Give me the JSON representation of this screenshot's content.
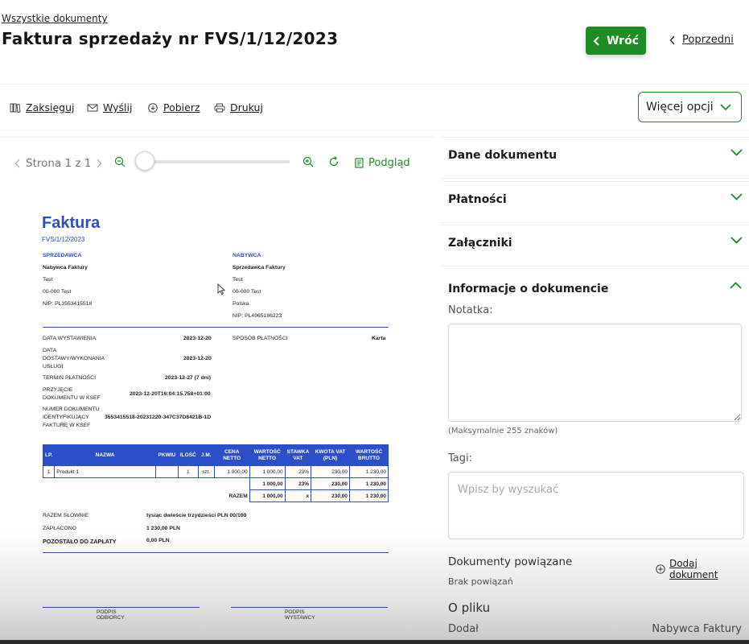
{
  "breadcrumb": "Wszystkie dokumenty",
  "title": "Faktura sprzedaży nr FVS/1/12/2023",
  "header": {
    "back_label": "Wróć",
    "prev_label": "Poprzedni"
  },
  "toolbar": {
    "post": "Zaksięguj",
    "send": "Wyślij",
    "download": "Pobierz",
    "print": "Drukuj",
    "more": "Więcej opcji"
  },
  "viewer": {
    "page_label": "Strona 1 z 1",
    "preview_label": "Podgląd"
  },
  "invoice": {
    "heading": "Faktura",
    "number": "FVS/1/12/2023",
    "seller_label": "SPRZEDAWCA",
    "seller_name": "Nabywca Faktury",
    "seller_line1": "Test",
    "seller_line2": "00-000 Test",
    "seller_nip": "NIP: PL3553415518",
    "buyer_label": "NABYWCA",
    "buyer_name": "Sprzedawca Faktury",
    "buyer_line1": "Test",
    "buyer_line2": "00-000 Test",
    "buyer_line3": "Polska",
    "buyer_nip": "NIP: PL4965186223",
    "issue_date_label": "DATA WYSTAWIENIA",
    "issue_date": "2023-12-20",
    "payment_method_label": "SPOSÓB PŁATNOŚCI",
    "payment_method": "Karta",
    "delivery_label_1": "DATA",
    "delivery_label_2": "DOSTAWY/WYKONANIA",
    "delivery_label_3": "USŁUGI",
    "delivery_date": "2023-12-20",
    "due_label": "TERMIN PŁATNOŚCI",
    "due_date": "2023-12-27 (7 dni)",
    "ksef_label_1": "PRZYJĘCIE",
    "ksef_label_2": "DOKUMENTU W KSEF",
    "ksef_date": "2023-12-20T16:04:15.758+01:00",
    "ksef_id_label_1": "NUMER DOKUMENTU",
    "ksef_id_label_2": "IDENTYFIKUJĄCY",
    "ksef_id_label_3": "FAKTURĘ W KSEF",
    "ksef_id": "3553415518-20231220-347C37D8421B-1D",
    "table_headers": [
      "LP.",
      "NAZWA",
      "PKWIU",
      "ILOŚĆ",
      "J.M.",
      "CENA NETTO",
      "WARTOŚĆ NETTO",
      "STAWKA VAT",
      "KWOTA VAT (PLN)",
      "WARTOŚĆ BRUTTO"
    ],
    "row": [
      "1",
      "Produkt 1",
      "",
      "1",
      "szt.",
      "1 000,00",
      "1 000,00",
      "23%",
      "230,00",
      "1 230,00"
    ],
    "subtotal": [
      "1 000,00",
      "23%",
      "230,00",
      "1 230,00"
    ],
    "total_label": "RAZEM",
    "total": [
      "1 000,00",
      "x",
      "230,00",
      "1 230,00"
    ],
    "words_label": "RAZEM SŁOWNIE",
    "words_value": "tysiąc dwieście trzydzieści PLN 00/100",
    "paid_label": "ZAPŁACONO",
    "paid_value": "1 230,00 PLN",
    "remaining_label": "POZOSTAŁO DO ZAPŁATY",
    "remaining_value": "0,00 PLN",
    "sign_receiver": "PODPIS ODBIORCY",
    "sign_issuer": "PODPIS WYSTAWCY"
  },
  "panel": {
    "doc_data": "Dane dokumentu",
    "payments": "Płatności",
    "attachments": "Załączniki",
    "info": "Informacje o dokumencie",
    "note_label": "Notatka:",
    "note_help": "(Maksymalnie 255 znaków)",
    "tags_label": "Tagi:",
    "tags_placeholder": "Wpisz by wyszukać",
    "related_label": "Dokumenty powiązane",
    "add_doc": "Dodaj dokument",
    "no_related": "Brak powiązań",
    "file_title": "O pliku",
    "added_label": "Dodał",
    "added_value": "Nabywca Faktury"
  },
  "colors": {
    "accent": "#1f8b24",
    "invoice_blue": "#2c4fc9"
  },
  "icons": [
    "chevron-left-icon",
    "books-icon",
    "mail-icon",
    "download-icon",
    "printer-icon",
    "chevron-down-icon",
    "zoom-out-icon",
    "zoom-in-icon",
    "rotate-icon",
    "document-icon",
    "chevron-up-icon",
    "plus-circle-icon",
    "cursor-icon"
  ]
}
